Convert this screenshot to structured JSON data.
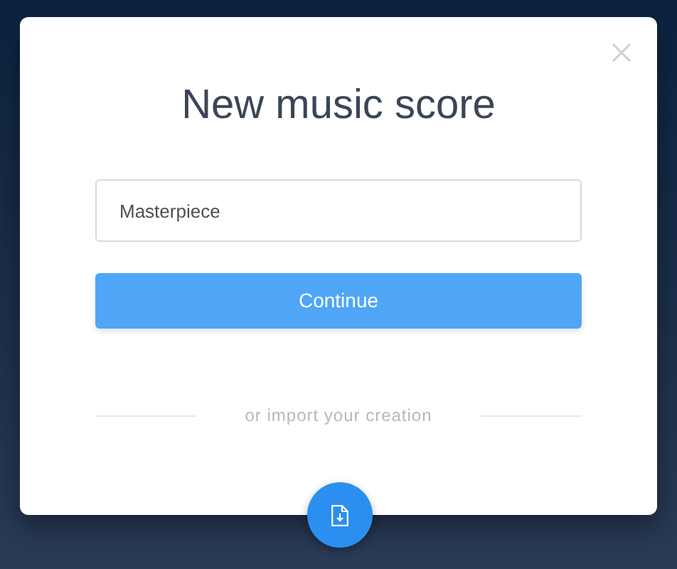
{
  "dialog": {
    "title": "New music score",
    "name_field": {
      "value": "Masterpiece"
    },
    "continue_button": "Continue",
    "divider_text": "or import your creation"
  }
}
